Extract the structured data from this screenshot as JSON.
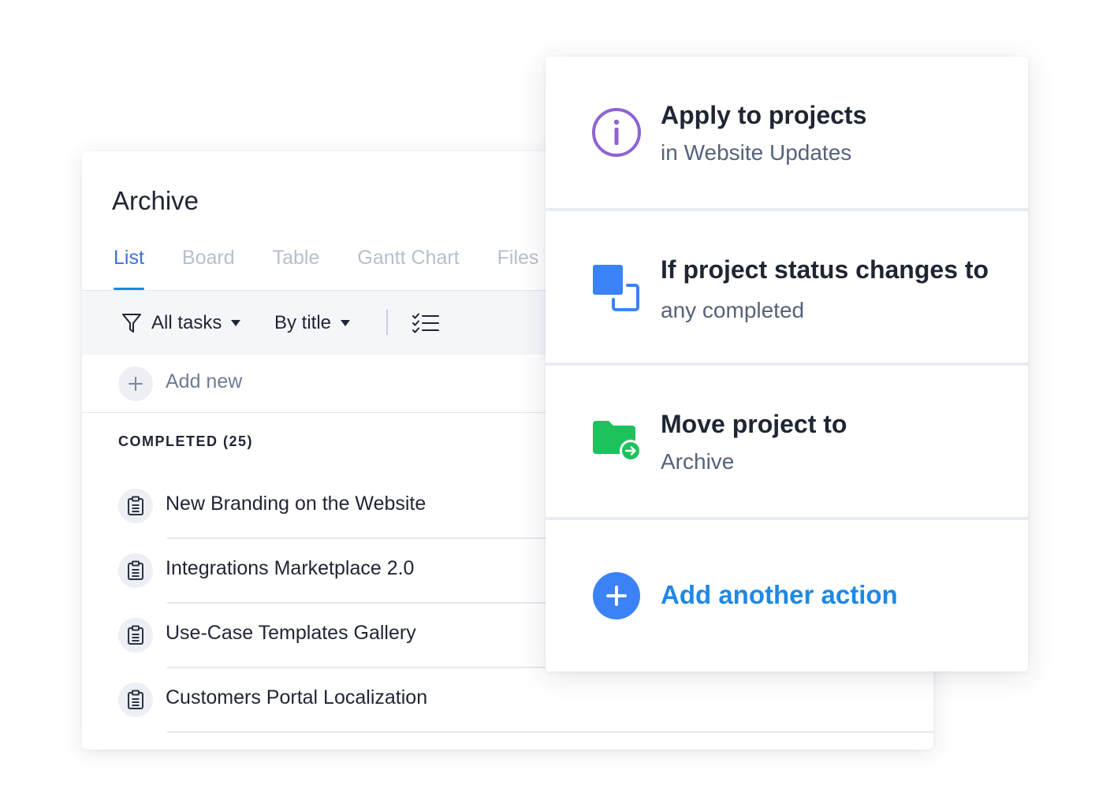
{
  "archive": {
    "title": "Archive",
    "tabs": [
      {
        "label": "List",
        "active": true
      },
      {
        "label": "Board",
        "active": false
      },
      {
        "label": "Table",
        "active": false
      },
      {
        "label": "Gantt Chart",
        "active": false
      },
      {
        "label": "Files",
        "active": false
      }
    ],
    "toolbar": {
      "filter_label": "All tasks",
      "sort_label": "By title"
    },
    "add_new_label": "Add new",
    "section_title": "COMPLETED (25)",
    "tasks": [
      {
        "name": "New Branding on the Website",
        "icon": "clipboard-icon"
      },
      {
        "name": "Integrations Marketplace 2.0",
        "icon": "clipboard-icon"
      },
      {
        "name": "Use-Case Templates Gallery",
        "icon": "clipboard-icon"
      },
      {
        "name": "Customers Portal Localization",
        "icon": "clipboard-icon"
      }
    ]
  },
  "automation": {
    "steps": [
      {
        "title": "Apply to projects",
        "subtitle": "in Website Updates",
        "icon": "info-icon",
        "color": "#8e63d4"
      },
      {
        "title": "If project status changes to",
        "subtitle": "any completed",
        "icon": "status-change-icon",
        "color": "#3b82f6"
      },
      {
        "title": "Move project to",
        "subtitle": "Archive",
        "icon": "folder-move-icon",
        "color": "#1dc25d"
      }
    ],
    "add_action_label": "Add another action"
  },
  "colors": {
    "accent_blue": "#1e88e5",
    "purple": "#8e63d4",
    "green": "#1dc25d",
    "text_dark": "#1f2533",
    "text_muted": "#55627a",
    "tab_inactive": "#b6bfcc"
  }
}
